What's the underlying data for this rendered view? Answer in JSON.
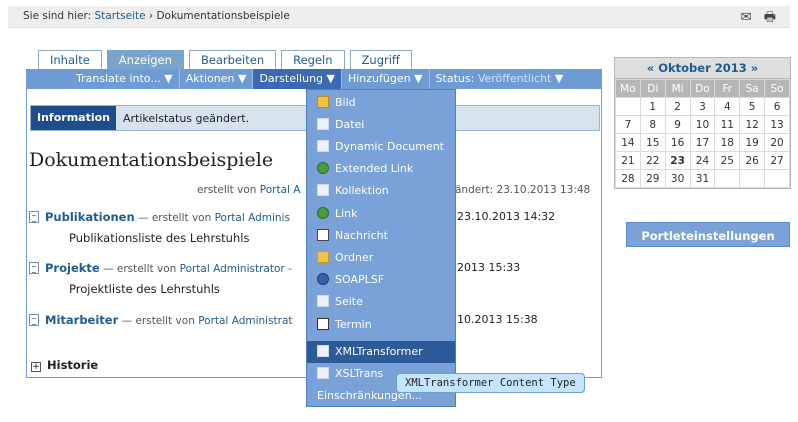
{
  "breadcrumb": {
    "prefix": "Sie sind hier:",
    "home": "Startseite",
    "separator": "›",
    "current": "Dokumentationsbeispiele"
  },
  "tools": {
    "mail_icon": "✉",
    "print_icon": "🖶"
  },
  "tabs": [
    "Inhalte",
    "Anzeigen",
    "Bearbeiten",
    "Regeln",
    "Zugriff"
  ],
  "actions": {
    "translate": "Translate into... ▼",
    "aktionen": "Aktionen ▼",
    "darstellung": "Darstellung ▼",
    "hinzufuegen": "Hinzufügen ▼",
    "status_label": "Status:",
    "status_value": "Veröffentlicht",
    "status_arrow": "▼"
  },
  "info": {
    "label": "Information",
    "message": "Artikelstatus geändert."
  },
  "document": {
    "title": "Dokumentationsbeispiele",
    "byline_prefix": "erstellt von",
    "byline_author": "Portal A",
    "modified": "ändert: 23.10.2013 13:48"
  },
  "entries": [
    {
      "title": "Publikationen",
      "meta_prefix": " — erstellt von ",
      "author": "Portal Adminis",
      "date": "23.10.2013 14:32",
      "description": "Publikationsliste des Lehrstuhls"
    },
    {
      "title": "Projekte",
      "meta_prefix": " — erstellt von ",
      "author": "Portal Administrator -",
      "date": "2013 15:33",
      "description": "Projektliste des Lehrstuhls"
    },
    {
      "title": "Mitarbeiter",
      "meta_prefix": " — erstellt von ",
      "author": "Portal Administrat",
      "date": "10.2013 15:38",
      "description": ""
    }
  ],
  "historie": {
    "toggle": "+",
    "label": "Historie"
  },
  "menu": {
    "items": [
      "Bild",
      "Datei",
      "Dynamic Document",
      "Extended Link",
      "Kollektion",
      "Link",
      "Nachricht",
      "Ordner",
      "SOAPLSF",
      "Seite",
      "Termin",
      "XMLTransformer",
      "XSLTrans"
    ],
    "footer": "Einschränkungen..."
  },
  "tooltip": "XMLTransformer Content Type",
  "calendar": {
    "prev": "«",
    "month": "Oktober 2013",
    "next": "»",
    "weekdays": [
      "Mo",
      "Di",
      "Mi",
      "Do",
      "Fr",
      "Sa",
      "So"
    ],
    "weeks": [
      [
        "",
        "1",
        "2",
        "3",
        "4",
        "5",
        "6"
      ],
      [
        "7",
        "8",
        "9",
        "10",
        "11",
        "12",
        "13"
      ],
      [
        "14",
        "15",
        "16",
        "17",
        "18",
        "19",
        "20"
      ],
      [
        "21",
        "22",
        "23",
        "24",
        "25",
        "26",
        "27"
      ],
      [
        "28",
        "29",
        "30",
        "31",
        "",
        "",
        ""
      ]
    ],
    "today": "23"
  },
  "portlet_button": "Portleteinstellungen"
}
